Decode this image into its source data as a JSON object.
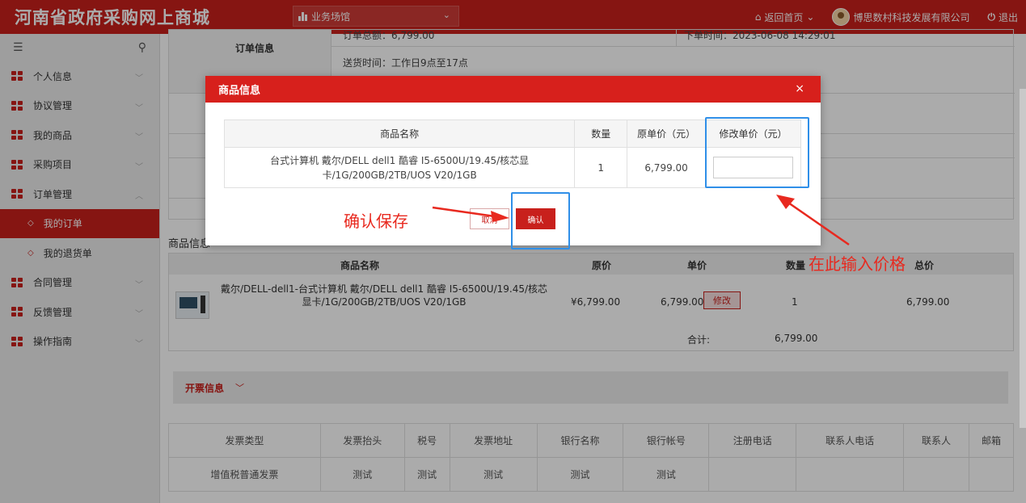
{
  "header": {
    "title": "河南省政府采购网上商城",
    "venue": "业务场馆",
    "home_link": "返回首页",
    "company": "博思数村科技发展有限公司",
    "logout": "退出"
  },
  "sidebar": {
    "items": [
      {
        "label": "个人信息"
      },
      {
        "label": "协议管理"
      },
      {
        "label": "我的商品"
      },
      {
        "label": "采购项目"
      },
      {
        "label": "订单管理"
      },
      {
        "label": "合同管理"
      },
      {
        "label": "反馈管理"
      },
      {
        "label": "操作指南"
      }
    ],
    "sub_items": [
      {
        "label": "我的订单"
      },
      {
        "label": "我的退货单"
      }
    ]
  },
  "order": {
    "label": "订单信息",
    "total": "订单总额：6,799.00",
    "order_time": "下单时间：2023-06-08 14:29:01",
    "delivery": "送货时间：工作日9点至17点"
  },
  "goods": {
    "section_label": "商品信息",
    "headers": {
      "name": "商品名称",
      "orig": "原价",
      "unit": "单价",
      "qty": "数量",
      "total": "总价"
    },
    "row": {
      "name": "戴尔/DELL-dell1-台式计算机 戴尔/DELL dell1 酷睿 I5-6500U/19.45/核芯显卡/1G/200GB/2TB/UOS V20/1GB",
      "orig": "¥6,799.00",
      "unit": "6,799.00",
      "edit": "修改",
      "qty": "1",
      "total": "6,799.00"
    },
    "sum_label": "合计:",
    "sum_value": "6,799.00"
  },
  "invoice": {
    "title": "开票信息",
    "headers": [
      "发票类型",
      "发票抬头",
      "税号",
      "发票地址",
      "银行名称",
      "银行帐号",
      "注册电话",
      "联系人电话",
      "联系人",
      "邮箱"
    ],
    "row": [
      "增值税普通发票",
      "测试",
      "测试",
      "测试",
      "测试",
      "测试",
      "",
      "",
      "",
      ""
    ]
  },
  "modal": {
    "title": "商品信息",
    "close": "×",
    "headers": {
      "name": "商品名称",
      "qty": "数量",
      "orig": "原单价（元）",
      "new": "修改单价（元）"
    },
    "row": {
      "name": "台式计算机 戴尔/DELL dell1 酷睿 I5-6500U/19.45/核芯显卡/1G/200GB/2TB/UOS V20/1GB",
      "qty": "1",
      "orig": "6,799.00",
      "new_value": ""
    },
    "cancel": "取消",
    "confirm": "确认"
  },
  "annotations": {
    "save": "确认保存",
    "enter_price": "在此输入价格",
    "color": "#e8291f",
    "box_color": "#2f8fe8"
  }
}
